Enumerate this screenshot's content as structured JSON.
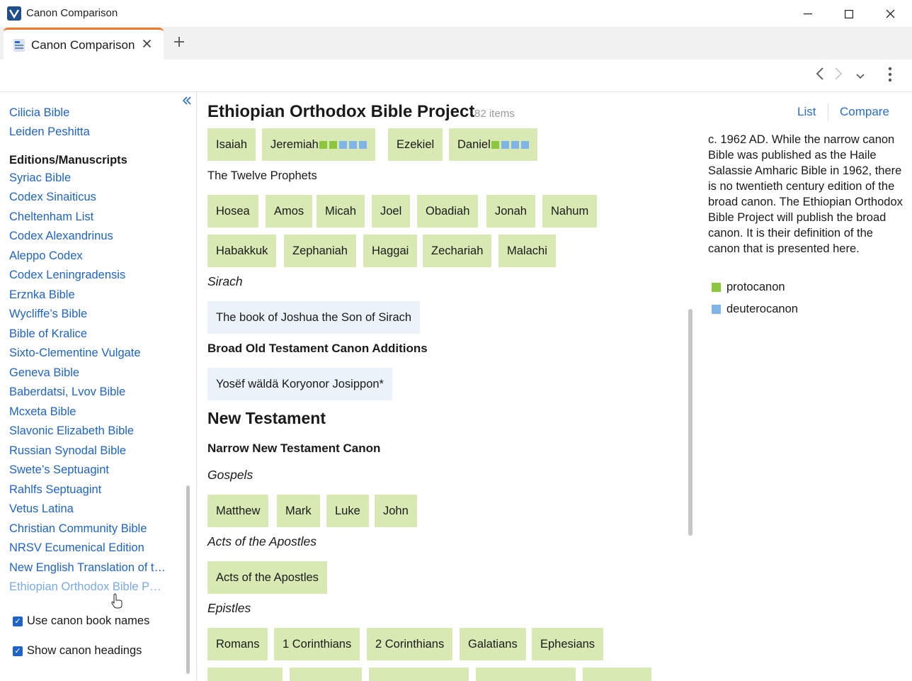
{
  "window": {
    "title": "Canon Comparison"
  },
  "tab": {
    "label": "Canon Comparison"
  },
  "sidebar": {
    "links_top": [
      "Cilicia Bible",
      "Leiden Peshitta"
    ],
    "section_heading": "Editions/Manuscripts",
    "links": [
      "Syriac Bible",
      "Codex Sinaiticus",
      "Cheltenham List",
      "Codex Alexandrinus",
      "Aleppo Codex",
      "Codex Leningradensis",
      "Erznka Bible",
      "Wycliffe’s Bible",
      "Bible of Kralice",
      "Sixto-Clementine Vulgate",
      "Geneva Bible",
      "Baberdatsi, Lvov Bible",
      "Mcxeta Bible",
      "Slavonic Elizabeth Bible",
      "Russian Synodal Bible",
      "Swete’s Septuagint",
      "Rahlfs Septuagint",
      "Vetus Latina",
      "Christian Community Bible",
      "NRSV Ecumenical Edition",
      "New English Translation of t…",
      "Ethiopian Orthodox Bible P…"
    ],
    "options": {
      "use_canon_names": "Use canon book names",
      "show_headings": "Show canon headings"
    }
  },
  "main": {
    "title": "Ethiopian Orthodox Bible Project",
    "count": "82 items",
    "view_list": "List",
    "view_compare": "Compare",
    "row1": [
      "Isaiah",
      "Jeremiah",
      "Ezekiel",
      "Daniel"
    ],
    "twelve_heading": "The Twelve Prophets",
    "twelve_row1": [
      "Hosea",
      "Amos",
      "Micah",
      "Joel",
      "Obadiah",
      "Jonah",
      "Nahum"
    ],
    "twelve_row2": [
      "Habakkuk",
      "Zephaniah",
      "Haggai",
      "Zechariah",
      "Malachi"
    ],
    "sirach_heading": "Sirach",
    "sirach_book": "The book of Joshua the Son of Sirach",
    "broad_heading": "Broad Old Testament Canon Additions",
    "broad_book": "Yosëf wäldä Koryonor Josippon*",
    "nt_heading": "New Testament",
    "narrow_nt_heading": "Narrow New Testament Canon",
    "gospels_heading": "Gospels",
    "gospels": [
      "Matthew",
      "Mark",
      "Luke",
      "John"
    ],
    "acts_heading": "Acts of the Apostles",
    "acts_book": "Acts of the Apostles",
    "epistles_heading": "Epistles",
    "epistles": [
      "Romans",
      "1 Corinthians",
      "2 Corinthians",
      "Galatians",
      "Ephesians"
    ]
  },
  "description": "c. 1962 AD. While the narrow canon Bible was published as the Haile Salassie Amharic Bible in 1962, there is no twentieth century edition of the broad canon. The Ethiopian Orthodox Bible Project will publish the broad canon. It is their definition of the canon that is presented here.",
  "legend": {
    "protocanon": "protocanon",
    "deuterocanon": "deuterocanon"
  },
  "colors": {
    "protocanon": "#8cc63e",
    "deuterocanon": "#7fb4e8",
    "link": "#1f63c7",
    "tab_accent": "#f07a2e"
  }
}
